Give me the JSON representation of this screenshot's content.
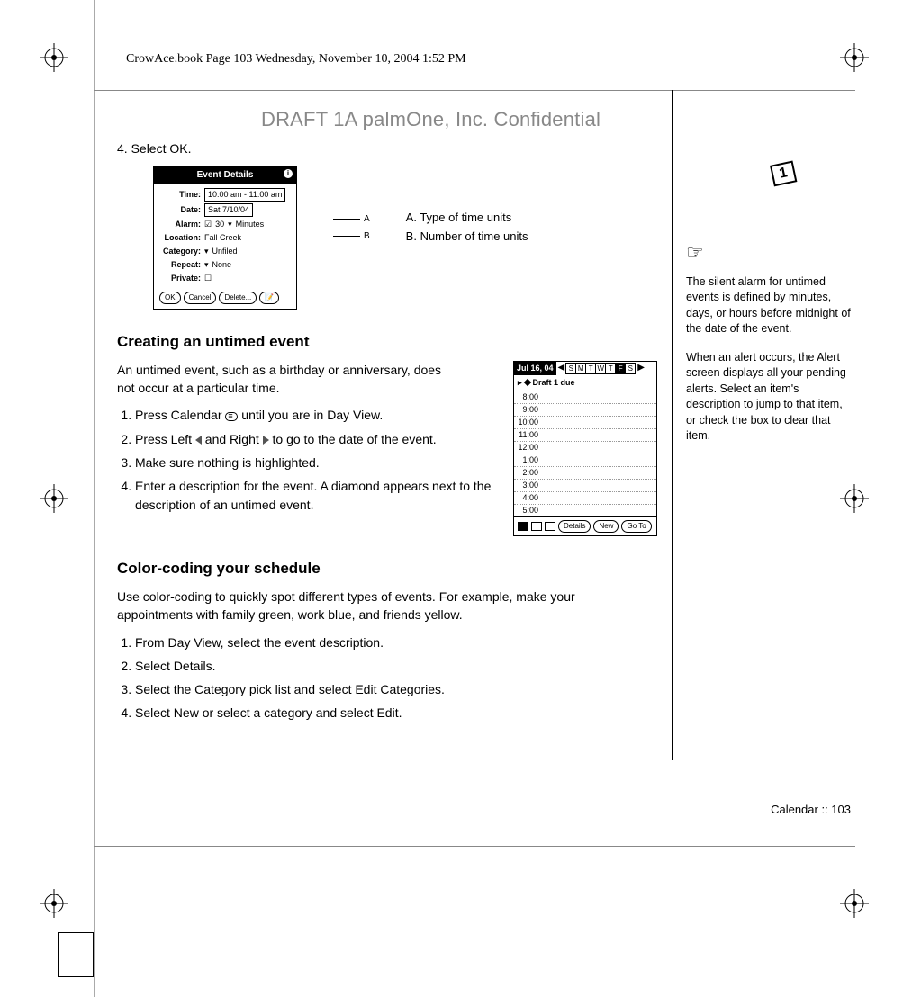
{
  "header_running": "CrowAce.book  Page 103  Wednesday, November 10, 2004  1:52 PM",
  "watermark": "DRAFT 1A  palmOne, Inc.   Confidential",
  "main": {
    "step4": "4.  Select OK.",
    "event_details": {
      "title": "Event Details",
      "rows": {
        "time_label": "Time:",
        "time_value": "10:00 am - 11:00 am",
        "date_label": "Date:",
        "date_value": "Sat 7/10/04",
        "alarm_label": "Alarm:",
        "alarm_value_num": "30",
        "alarm_value_unit": "Minutes",
        "location_label": "Location:",
        "location_value": "Fall Creek",
        "category_label": "Category:",
        "category_value": "Unfiled",
        "repeat_label": "Repeat:",
        "repeat_value": "None",
        "private_label": "Private:"
      },
      "buttons": {
        "ok": "OK",
        "cancel": "Cancel",
        "delete": "Delete..."
      }
    },
    "callout_A_letter": "A",
    "callout_B_letter": "B",
    "key_A": "A.   Type of time units",
    "key_B": "B.   Number of time units",
    "heading_untimed": "Creating an untimed event",
    "untimed_para": "An untimed event, such as a birthday or anniversary, does not occur at a particular time.",
    "untimed_steps": [
      "Press Calendar        until you are in Day View.",
      "Press Left   and Right   to go to the date of the event.",
      "Make sure nothing is highlighted.",
      "Enter a description for the event. A diamond appears next to the description of an untimed event."
    ],
    "day_view": {
      "date": "Jul 16, 04",
      "days": [
        "S",
        "M",
        "T",
        "W",
        "T",
        "F",
        "S"
      ],
      "untimed_item": "Draft 1 due",
      "times": [
        "8:00",
        "9:00",
        "10:00",
        "11:00",
        "12:00",
        "1:00",
        "2:00",
        "3:00",
        "4:00",
        "5:00"
      ],
      "buttons": {
        "details": "Details",
        "new": "New",
        "goto": "Go To"
      }
    },
    "heading_color": "Color-coding your schedule",
    "color_para": "Use color-coding to quickly spot different types of events. For example, make your appointments with family green, work blue, and friends yellow.",
    "color_steps": [
      "From Day View, select the event description.",
      "Select Details.",
      "Select the Category pick list and select Edit Categories.",
      "Select New or select a category and select Edit."
    ]
  },
  "side": {
    "tip1": "The silent alarm for untimed events is defined by minutes, days, or hours before midnight of the date of the event.",
    "tip2": "When an alert occurs, the Alert screen displays all your pending alerts. Select an item's description to jump to that item, or check the box to clear that item."
  },
  "footer": "Calendar   ::   103"
}
